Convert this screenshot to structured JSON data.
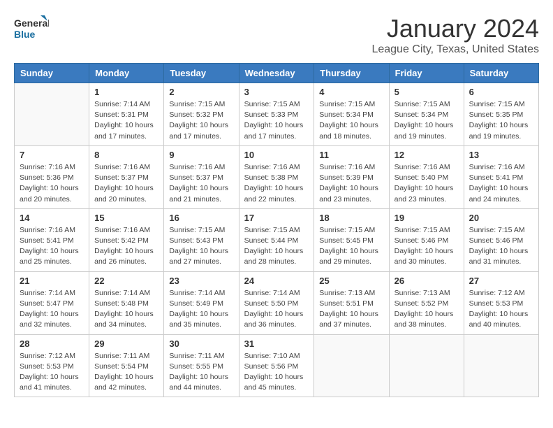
{
  "header": {
    "logo_general": "General",
    "logo_blue": "Blue",
    "title": "January 2024",
    "subtitle": "League City, Texas, United States"
  },
  "columns": [
    "Sunday",
    "Monday",
    "Tuesday",
    "Wednesday",
    "Thursday",
    "Friday",
    "Saturday"
  ],
  "weeks": [
    [
      {
        "day": "",
        "info": ""
      },
      {
        "day": "1",
        "info": "Sunrise: 7:14 AM\nSunset: 5:31 PM\nDaylight: 10 hours\nand 17 minutes."
      },
      {
        "day": "2",
        "info": "Sunrise: 7:15 AM\nSunset: 5:32 PM\nDaylight: 10 hours\nand 17 minutes."
      },
      {
        "day": "3",
        "info": "Sunrise: 7:15 AM\nSunset: 5:33 PM\nDaylight: 10 hours\nand 17 minutes."
      },
      {
        "day": "4",
        "info": "Sunrise: 7:15 AM\nSunset: 5:34 PM\nDaylight: 10 hours\nand 18 minutes."
      },
      {
        "day": "5",
        "info": "Sunrise: 7:15 AM\nSunset: 5:34 PM\nDaylight: 10 hours\nand 19 minutes."
      },
      {
        "day": "6",
        "info": "Sunrise: 7:15 AM\nSunset: 5:35 PM\nDaylight: 10 hours\nand 19 minutes."
      }
    ],
    [
      {
        "day": "7",
        "info": "Sunrise: 7:16 AM\nSunset: 5:36 PM\nDaylight: 10 hours\nand 20 minutes."
      },
      {
        "day": "8",
        "info": "Sunrise: 7:16 AM\nSunset: 5:37 PM\nDaylight: 10 hours\nand 20 minutes."
      },
      {
        "day": "9",
        "info": "Sunrise: 7:16 AM\nSunset: 5:37 PM\nDaylight: 10 hours\nand 21 minutes."
      },
      {
        "day": "10",
        "info": "Sunrise: 7:16 AM\nSunset: 5:38 PM\nDaylight: 10 hours\nand 22 minutes."
      },
      {
        "day": "11",
        "info": "Sunrise: 7:16 AM\nSunset: 5:39 PM\nDaylight: 10 hours\nand 23 minutes."
      },
      {
        "day": "12",
        "info": "Sunrise: 7:16 AM\nSunset: 5:40 PM\nDaylight: 10 hours\nand 23 minutes."
      },
      {
        "day": "13",
        "info": "Sunrise: 7:16 AM\nSunset: 5:41 PM\nDaylight: 10 hours\nand 24 minutes."
      }
    ],
    [
      {
        "day": "14",
        "info": "Sunrise: 7:16 AM\nSunset: 5:41 PM\nDaylight: 10 hours\nand 25 minutes."
      },
      {
        "day": "15",
        "info": "Sunrise: 7:16 AM\nSunset: 5:42 PM\nDaylight: 10 hours\nand 26 minutes."
      },
      {
        "day": "16",
        "info": "Sunrise: 7:15 AM\nSunset: 5:43 PM\nDaylight: 10 hours\nand 27 minutes."
      },
      {
        "day": "17",
        "info": "Sunrise: 7:15 AM\nSunset: 5:44 PM\nDaylight: 10 hours\nand 28 minutes."
      },
      {
        "day": "18",
        "info": "Sunrise: 7:15 AM\nSunset: 5:45 PM\nDaylight: 10 hours\nand 29 minutes."
      },
      {
        "day": "19",
        "info": "Sunrise: 7:15 AM\nSunset: 5:46 PM\nDaylight: 10 hours\nand 30 minutes."
      },
      {
        "day": "20",
        "info": "Sunrise: 7:15 AM\nSunset: 5:46 PM\nDaylight: 10 hours\nand 31 minutes."
      }
    ],
    [
      {
        "day": "21",
        "info": "Sunrise: 7:14 AM\nSunset: 5:47 PM\nDaylight: 10 hours\nand 32 minutes."
      },
      {
        "day": "22",
        "info": "Sunrise: 7:14 AM\nSunset: 5:48 PM\nDaylight: 10 hours\nand 34 minutes."
      },
      {
        "day": "23",
        "info": "Sunrise: 7:14 AM\nSunset: 5:49 PM\nDaylight: 10 hours\nand 35 minutes."
      },
      {
        "day": "24",
        "info": "Sunrise: 7:14 AM\nSunset: 5:50 PM\nDaylight: 10 hours\nand 36 minutes."
      },
      {
        "day": "25",
        "info": "Sunrise: 7:13 AM\nSunset: 5:51 PM\nDaylight: 10 hours\nand 37 minutes."
      },
      {
        "day": "26",
        "info": "Sunrise: 7:13 AM\nSunset: 5:52 PM\nDaylight: 10 hours\nand 38 minutes."
      },
      {
        "day": "27",
        "info": "Sunrise: 7:12 AM\nSunset: 5:53 PM\nDaylight: 10 hours\nand 40 minutes."
      }
    ],
    [
      {
        "day": "28",
        "info": "Sunrise: 7:12 AM\nSunset: 5:53 PM\nDaylight: 10 hours\nand 41 minutes."
      },
      {
        "day": "29",
        "info": "Sunrise: 7:11 AM\nSunset: 5:54 PM\nDaylight: 10 hours\nand 42 minutes."
      },
      {
        "day": "30",
        "info": "Sunrise: 7:11 AM\nSunset: 5:55 PM\nDaylight: 10 hours\nand 44 minutes."
      },
      {
        "day": "31",
        "info": "Sunrise: 7:10 AM\nSunset: 5:56 PM\nDaylight: 10 hours\nand 45 minutes."
      },
      {
        "day": "",
        "info": ""
      },
      {
        "day": "",
        "info": ""
      },
      {
        "day": "",
        "info": ""
      }
    ]
  ]
}
